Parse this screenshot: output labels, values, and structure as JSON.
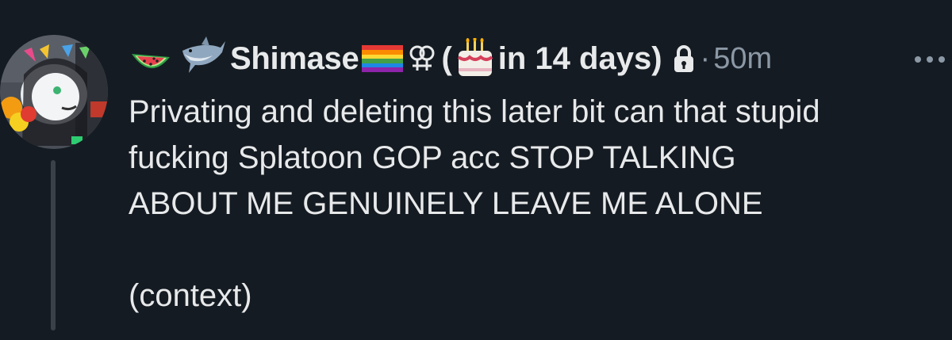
{
  "post": {
    "display_name": "Shimase",
    "birthday_prefix": "(",
    "birthday_text": "in 14 days)",
    "separator": "·",
    "time": "50m",
    "text": "Privating and deleting this later bit can that stupid\nfucking Splatoon GOP acc STOP TALKING\nABOUT ME GENUINELY LEAVE ME ALONE\n\n(context)",
    "name_icons": [
      "watermelon-icon",
      "shark-icon",
      "rainbow-flag-icon",
      "double-venus-icon",
      "birthday-cake-icon",
      "lock-icon"
    ],
    "more_icon": "more-options-icon"
  },
  "colors": {
    "background": "#151b22",
    "text": "#e7e9ea",
    "muted": "#8b98a5",
    "thread_line": "#3b4148"
  }
}
